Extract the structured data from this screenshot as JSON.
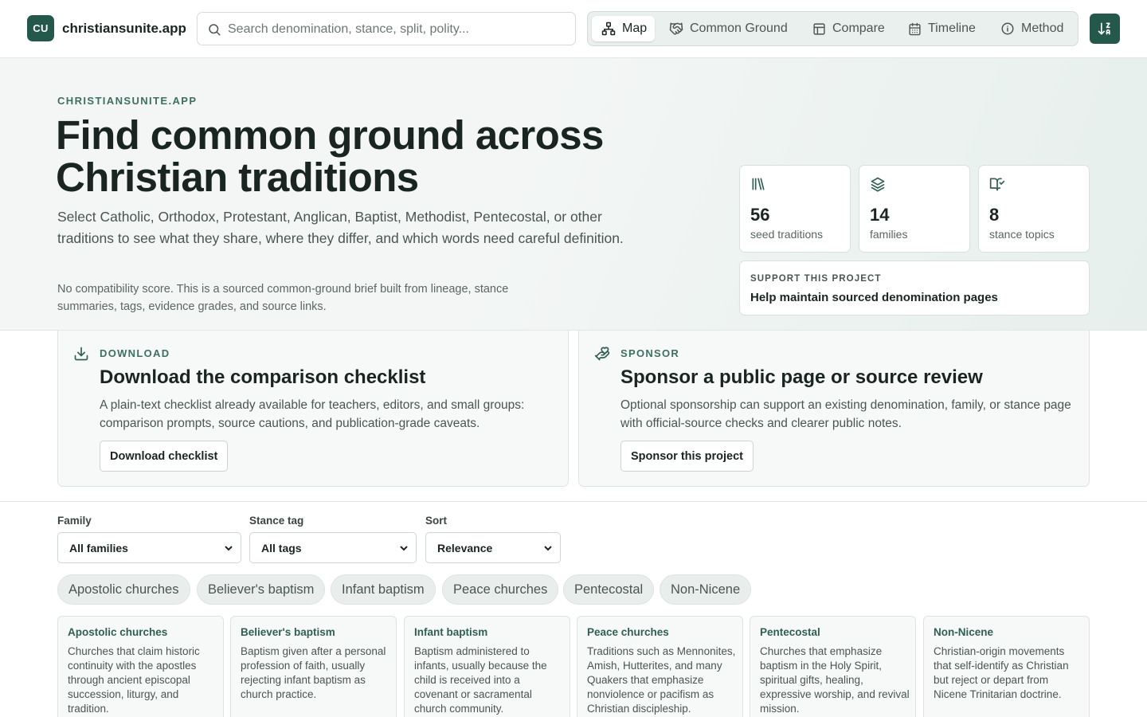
{
  "header": {
    "logo_badge": "CU",
    "site_name": "christiansunite.app",
    "search_placeholder": "Search denomination, stance, split, polity...",
    "nav": [
      {
        "label": "Map",
        "icon": "network-icon",
        "active": true
      },
      {
        "label": "Common Ground",
        "icon": "handshake-icon",
        "active": false
      },
      {
        "label": "Compare",
        "icon": "table-icon",
        "active": false
      },
      {
        "label": "Timeline",
        "icon": "calendar-icon",
        "active": false
      },
      {
        "label": "Method",
        "icon": "info-icon",
        "active": false
      }
    ],
    "sort_icon": "sort-az-icon"
  },
  "hero": {
    "eyebrow": "CHRISTIANSUNITE.APP",
    "title": "Find common ground across Christian traditions",
    "lede": "Select Catholic, Orthodox, Protestant, Anglican, Baptist, Methodist, Pentecostal, or other traditions to see what they share, where they differ, and which words need careful definition.",
    "note": "No compatibility score. This is a sourced common-ground brief built from lineage, stance summaries, tags, evidence grades, and source links.",
    "stats": [
      {
        "value": "56",
        "label": "seed traditions",
        "icon": "library-icon"
      },
      {
        "value": "14",
        "label": "families",
        "icon": "layers-icon"
      },
      {
        "value": "8",
        "label": "stance topics",
        "icon": "book-check-icon"
      }
    ],
    "support": {
      "eyebrow": "SUPPORT THIS PROJECT",
      "title": "Help maintain sourced denomination pages"
    }
  },
  "promos": {
    "download": {
      "eyebrow": "DOWNLOAD",
      "title": "Download the comparison checklist",
      "desc": "A plain-text checklist already available for teachers, editors, and small groups: comparison prompts, source cautions, and publication-grade caveats.",
      "button": "Download checklist"
    },
    "sponsor": {
      "eyebrow": "SPONSOR",
      "title": "Sponsor a public page or source review",
      "desc": "Optional sponsorship can support an existing denomination, family, or stance page with official-source checks and clearer public notes.",
      "button": "Sponsor this project"
    }
  },
  "filters": {
    "family": {
      "label": "Family",
      "value": "All families"
    },
    "stance": {
      "label": "Stance tag",
      "value": "All tags"
    },
    "sort": {
      "label": "Sort",
      "value": "Relevance"
    }
  },
  "chips": [
    "Apostolic churches",
    "Believer's baptism",
    "Infant baptism",
    "Peace churches",
    "Pentecostal",
    "Non-Nicene"
  ],
  "topics": [
    {
      "title": "Apostolic churches",
      "desc": "Churches that claim historic continuity with the apostles through ancient episcopal succession, liturgy, and tradition."
    },
    {
      "title": "Believer's baptism",
      "desc": "Baptism given after a personal profession of faith, usually rejecting infant baptism as church practice."
    },
    {
      "title": "Infant baptism",
      "desc": "Baptism administered to infants, usually because the child is received into a covenant or sacramental church community."
    },
    {
      "title": "Peace churches",
      "desc": "Traditions such as Mennonites, Amish, Hutterites, and many Quakers that emphasize nonviolence or pacifism as Christian discipleship."
    },
    {
      "title": "Pentecostal",
      "desc": "Churches that emphasize baptism in the Holy Spirit, spiritual gifts, healing, expressive worship, and revival mission."
    },
    {
      "title": "Non-Nicene",
      "desc": "Christian-origin movements that self-identify as Christian but reject or depart from Nicene Trinitarian doctrine."
    }
  ],
  "colors": {
    "brand": "#24584b",
    "accent_text": "#3d6f62",
    "nav_bg": "#eaf0ee",
    "chip_bg": "#e9eeec"
  }
}
